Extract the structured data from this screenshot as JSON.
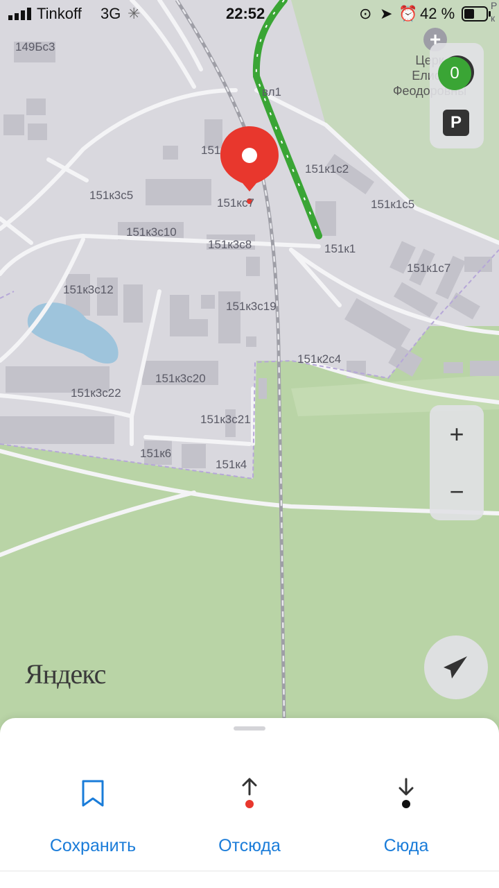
{
  "status_bar": {
    "carrier": "Tinkoff",
    "network": "3G",
    "time": "22:52",
    "battery": "42 %"
  },
  "map": {
    "building_labels": [
      "149Бс3",
      "151к1",
      "151к1с2",
      "151к1с5",
      "151к1с7",
      "151к3с5",
      "151к3с10",
      "151к3с8",
      "151к3с12",
      "151к3с19",
      "151к3с20",
      "151к3с22",
      "151к3с21",
      "151к2с4",
      "151к6",
      "151к4",
      "151кс7",
      "151"
    ],
    "poi_label_lines": [
      "Церк",
      "Елиса",
      "Феодоровны"
    ],
    "poi_extra": [
      "Р",
      "к"
    ],
    "parking_count": "0",
    "parking_label": "P",
    "logo": "Яндекс"
  },
  "controls": {
    "zoom_in": "+",
    "zoom_out": "−"
  },
  "sheet": {
    "save_label": "Сохранить",
    "from_label": "Отсюда",
    "to_label": "Сюда"
  },
  "colors": {
    "accent": "#1a7cd9",
    "pin": "#e8372d",
    "route": "#3aa535",
    "park": "#b9d4a6",
    "urban": "#d9d8de"
  }
}
